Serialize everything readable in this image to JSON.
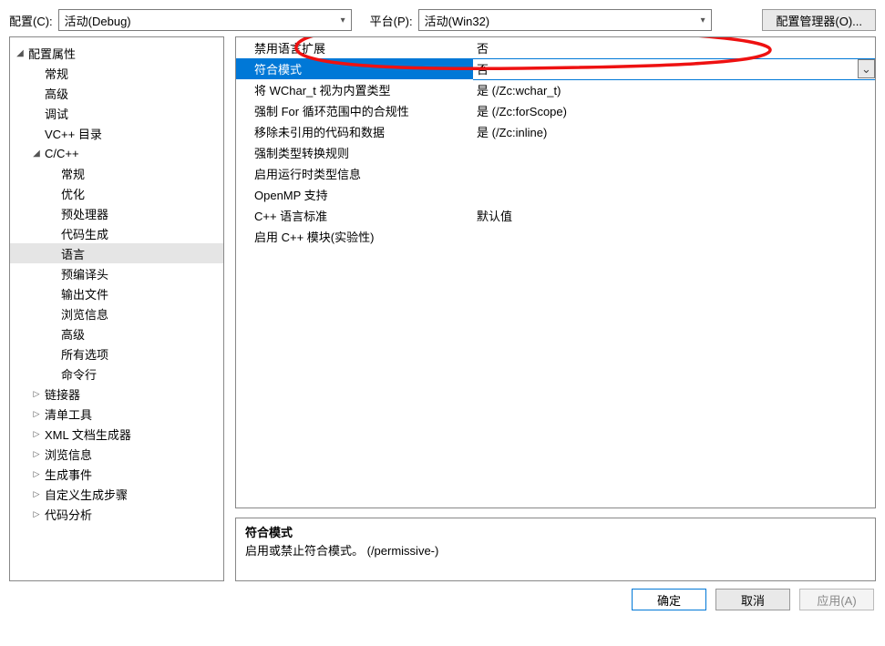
{
  "toolbar": {
    "config_label": "配置(C):",
    "config_value": "活动(Debug)",
    "platform_label": "平台(P):",
    "platform_value": "活动(Win32)",
    "manager_button": "配置管理器(O)..."
  },
  "tree": {
    "root": {
      "label": "配置属性",
      "expanded": true
    },
    "items_lvl1_top": [
      {
        "label": "常规"
      },
      {
        "label": "高级"
      },
      {
        "label": "调试"
      },
      {
        "label": "VC++ 目录"
      }
    ],
    "ccpp": {
      "label": "C/C++",
      "expanded": true
    },
    "ccpp_children": [
      {
        "label": "常规"
      },
      {
        "label": "优化"
      },
      {
        "label": "预处理器"
      },
      {
        "label": "代码生成"
      },
      {
        "label": "语言",
        "selected": true
      },
      {
        "label": "预编译头"
      },
      {
        "label": "输出文件"
      },
      {
        "label": "浏览信息"
      },
      {
        "label": "高级"
      },
      {
        "label": "所有选项"
      },
      {
        "label": "命令行"
      }
    ],
    "items_lvl1_bottom": [
      {
        "label": "链接器"
      },
      {
        "label": "清单工具"
      },
      {
        "label": "XML 文档生成器"
      },
      {
        "label": "浏览信息"
      },
      {
        "label": "生成事件"
      },
      {
        "label": "自定义生成步骤"
      },
      {
        "label": "代码分析"
      }
    ]
  },
  "grid": {
    "rows": [
      {
        "name": "禁用语言扩展",
        "value": "否"
      },
      {
        "name": "符合模式",
        "value": "否",
        "selected": true
      },
      {
        "name": "将 WChar_t 视为内置类型",
        "value": "是 (/Zc:wchar_t)"
      },
      {
        "name": "强制 For 循环范围中的合规性",
        "value": "是 (/Zc:forScope)"
      },
      {
        "name": "移除未引用的代码和数据",
        "value": "是 (/Zc:inline)"
      },
      {
        "name": "强制类型转换规则",
        "value": ""
      },
      {
        "name": "启用运行时类型信息",
        "value": ""
      },
      {
        "name": "OpenMP 支持",
        "value": ""
      },
      {
        "name": "C++ 语言标准",
        "value": "默认值"
      },
      {
        "name": "启用 C++ 模块(实验性)",
        "value": ""
      }
    ]
  },
  "description": {
    "title": "符合模式",
    "body": "启用或禁止符合模式。     (/permissive-)"
  },
  "footer": {
    "ok": "确定",
    "cancel": "取消",
    "apply": "应用(A)"
  }
}
